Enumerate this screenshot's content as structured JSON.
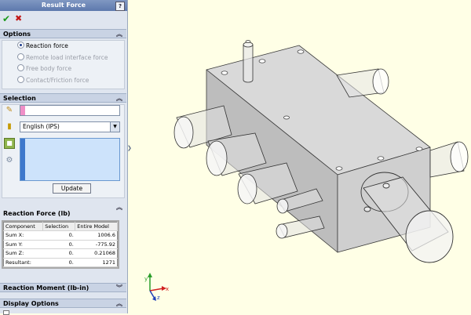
{
  "window": {
    "title": "Result Force",
    "help": "?"
  },
  "actions": {
    "ok": "✔",
    "cancel": "✖"
  },
  "options": {
    "header": "Options",
    "radios": [
      {
        "label": "Reaction force",
        "selected": true,
        "enabled": true
      },
      {
        "label": "Remote load interface force",
        "selected": false,
        "enabled": false
      },
      {
        "label": "Free body force",
        "selected": false,
        "enabled": false
      },
      {
        "label": "Contact/Friction force",
        "selected": false,
        "enabled": false
      }
    ]
  },
  "selection": {
    "header": "Selection",
    "units": "English (IPS)",
    "update_label": "Update"
  },
  "reaction_force": {
    "header": "Reaction Force (lb)",
    "columns": [
      "Component",
      "Selection",
      "Entire Model"
    ],
    "rows": [
      {
        "component": "Sum X:",
        "selection": "0.",
        "entire": "1006.6"
      },
      {
        "component": "Sum Y:",
        "selection": "0.",
        "entire": "-775.92"
      },
      {
        "component": "Sum Z:",
        "selection": "0.",
        "entire": "0.21068"
      },
      {
        "component": "Resultant:",
        "selection": "0.",
        "entire": "1271"
      }
    ]
  },
  "reaction_moment": {
    "header": "Reaction Moment (lb-in)"
  },
  "display_options": {
    "header": "Display Options"
  },
  "chevron": "︽",
  "colors": {
    "title_bar": "#6d87b8",
    "panel_bg": "#dfe5ef",
    "viewport_bg": "#ffffe6",
    "model_face": "#c9c9c9"
  }
}
